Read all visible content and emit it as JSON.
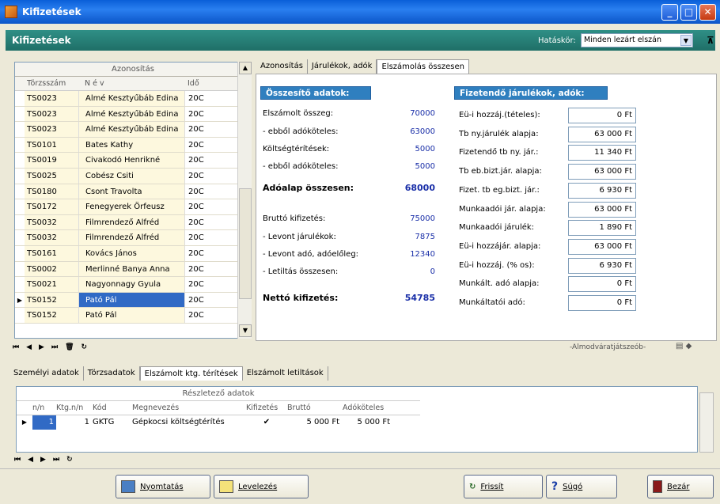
{
  "window": {
    "title": "Kifizetések"
  },
  "header": {
    "title": "Kifizetések",
    "hataskor_label": "Hatáskör:",
    "hataskor_value": "Minden lezárt elszán"
  },
  "left_grid": {
    "group_header": "Azonosítás",
    "columns": [
      "Törzsszám",
      "N é v",
      "Idő"
    ],
    "rows": [
      [
        "TS0023",
        "Almé Kesztyűbáb Edina",
        "20C"
      ],
      [
        "TS0023",
        "Almé Kesztyűbáb Edina",
        "20C"
      ],
      [
        "TS0023",
        "Almé Kesztyűbáb Edina",
        "20C"
      ],
      [
        "TS0101",
        "Bates Kathy",
        "20C"
      ],
      [
        "TS0019",
        "Civakodó Henrikné",
        "20C"
      ],
      [
        "TS0025",
        "Cobész Csiti",
        "20C"
      ],
      [
        "TS0180",
        "Csont Travolta",
        "20C"
      ],
      [
        "TS0172",
        "Fenegyerek Örfeusz",
        "20C"
      ],
      [
        "TS0032",
        "Filmrendező Alfréd",
        "20C"
      ],
      [
        "TS0032",
        "Filmrendező Alfréd",
        "20C"
      ],
      [
        "TS0161",
        "Kovács János",
        "20C"
      ],
      [
        "TS0002",
        "Merlinné Banya Anna",
        "20C"
      ],
      [
        "TS0021",
        "Nagyonnagy Gyula",
        "20C"
      ],
      [
        "TS0152",
        "Pató Pál",
        "20C"
      ],
      [
        "TS0152",
        "Pató Pál",
        "20C"
      ]
    ],
    "selected_row": 13
  },
  "right_tabs": [
    "Azonosítás",
    "Járulékok, adók",
    "Elszámolás összesen"
  ],
  "summary": {
    "title": "Összesítő adatok:",
    "items": [
      {
        "label": "Elszámolt összeg:",
        "value": "70000",
        "bold": false
      },
      {
        "label": "- ebből adóköteles:",
        "value": "63000",
        "bold": false
      },
      {
        "label": "Költségtérítések:",
        "value": "5000",
        "bold": false
      },
      {
        "label": "- ebből adóköteles:",
        "value": "5000",
        "bold": false
      },
      {
        "label": "Adóalap összesen:",
        "value": "68000",
        "bold": true
      },
      {
        "label": "Bruttó kifizetés:",
        "value": "75000",
        "bold": false
      },
      {
        "label": "- Levont járulékok:",
        "value": "7875",
        "bold": false
      },
      {
        "label": "- Levont adó, adóelőleg:",
        "value": "12340",
        "bold": false
      },
      {
        "label": "- Letiltás összesen:",
        "value": "0",
        "bold": false
      },
      {
        "label": "Nettó kifizetés:",
        "value": "54785",
        "bold": true
      }
    ]
  },
  "payable": {
    "title": "Fizetendő járulékok, adók:",
    "items": [
      {
        "label": "Eü-i hozzáj.(tételes):",
        "value": "0 Ft"
      },
      {
        "label": "Tb ny.járulék alapja:",
        "value": "63 000 Ft"
      },
      {
        "label": "Fizetendő tb ny. jár.:",
        "value": "11 340 Ft"
      },
      {
        "label": "Tb eb.bizt.jár. alapja:",
        "value": "63 000 Ft"
      },
      {
        "label": "Fizet. tb eg.bizt. jár.:",
        "value": "6 930 Ft"
      },
      {
        "label": "Munkaadói jár. alapja:",
        "value": "63 000 Ft"
      },
      {
        "label": "Munkaadói járulék:",
        "value": "1 890 Ft"
      },
      {
        "label": "Eü-i hozzájár. alapja:",
        "value": "63 000 Ft"
      },
      {
        "label": "Eü-i hozzáj. (% os):",
        "value": "6 930 Ft"
      },
      {
        "label": "Munkált. adó alapja:",
        "value": "0 Ft"
      },
      {
        "label": "Munkáltatói adó:",
        "value": "0 Ft"
      }
    ]
  },
  "right_nav_text": "-Almodváratjátszeób-",
  "bottom_tabs": [
    "Személyi adatok",
    "Törzsadatok",
    "Elszámolt ktg. térítések",
    "Elszámolt letiltások"
  ],
  "bottom_grid": {
    "group_header": "Részletező adatok",
    "columns": [
      "n/n",
      "Ktg.n/n",
      "Kód",
      "Megnevezés",
      "Kifizetés",
      "Bruttó",
      "Adóköteles"
    ],
    "row": {
      "nn": "1",
      "ktgnn": "1",
      "kod": "GKTG",
      "megnevezes": "Gépkocsi költségtérítés",
      "kifizetes": "✔",
      "brutto": "5 000 Ft",
      "adokoteles": "5 000 Ft"
    }
  },
  "buttons": {
    "print": "Nyomtatás",
    "mail": "Levelezés",
    "refresh": "Frissít",
    "help": "Súgó",
    "close": "Bezár"
  }
}
